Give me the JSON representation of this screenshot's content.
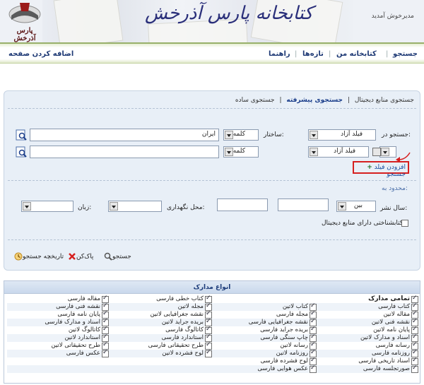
{
  "header": {
    "site_title": "کتابخانه پارس آذرخش",
    "logo_text": "پارس آذرخش",
    "welcome": "مدیرخوش آمدید"
  },
  "nav": {
    "search": "جستجو",
    "my_library": "کتابخانه من",
    "news": "تازه‌ها",
    "help": "راهنما",
    "add_page": "اضافه کردن صفحه"
  },
  "tabs": {
    "simple": "جستجوی ساده",
    "advanced": "جستجوی پیشرفته",
    "digital": "جستجوی منابع دیجیتال",
    "sep": "|"
  },
  "search_row1": {
    "label_search_in": "جستجو در:",
    "field": "فیلد آزاد",
    "label_structure": "ساختار:",
    "structure": "کلمه",
    "value": "ایران"
  },
  "search_row2": {
    "operator": "و",
    "field": "فیلد آزاد",
    "structure": "کلمه",
    "value": ""
  },
  "add_field": "افزودن فیلد جستجو",
  "limit": {
    "label": "محدود به:",
    "pub_year_label": "سال نشر:",
    "pub_year_mode": "بین",
    "location_label": "محل نگهداری:",
    "language_label": "زبان:",
    "digital_only": "کتابشناختی دارای منابع دیجیتال"
  },
  "buttons": {
    "search": "جستجو",
    "clear": "پاک‌کن",
    "history": "تاریخچه جستجو"
  },
  "doc_types": {
    "title": "انواع مدارک",
    "all": "تمامی مدارک",
    "col1": [
      "کتاب فارسی",
      "مقاله لاتین",
      "نقشه فنی لاتین",
      "پایان نامه لاتین",
      "اسناد و مدارک لاتین",
      "رسانه فارسی",
      "روزنامه فارسی",
      "اسناد تاریخی فارسی",
      "صورتجلسه فارسی"
    ],
    "col2": [
      "کتاب لاتین",
      "مجله فارسی",
      "نقشه جغرافیایی فارسی",
      "بریده جراید فارسی",
      "چاپ سنگی فارسی",
      "رسانه لاتین",
      "روزنامه لاتین",
      "لوح فشرده فارسی",
      "عکس هوایی فارسی"
    ],
    "col3": [
      "کتاب خطی فارسی",
      "مجله لاتین",
      "نقشه جغرافیایی لاتین",
      "بریده جراید لاتین",
      "کاتالوگ فارسی",
      "استاندارد فارسی",
      "طرح تحقیقاتی فارسی",
      "لوح فشرده لاتین"
    ],
    "col4": [
      "مقاله فارسی",
      "نقشه فنی فارسی",
      "پایان نامه فارسی",
      "اسناد و مدارک فارسی",
      "کاتالوگ لاتین",
      "استاندارد لاتین",
      "طرح تحقیقاتی لاتین",
      "عکس فارسی"
    ]
  },
  "colors": {
    "nav_text": "#1f3a75",
    "panel_bg": "#e8eff7",
    "accent_red": "#d62020",
    "link_blue": "#1a4ea0"
  }
}
